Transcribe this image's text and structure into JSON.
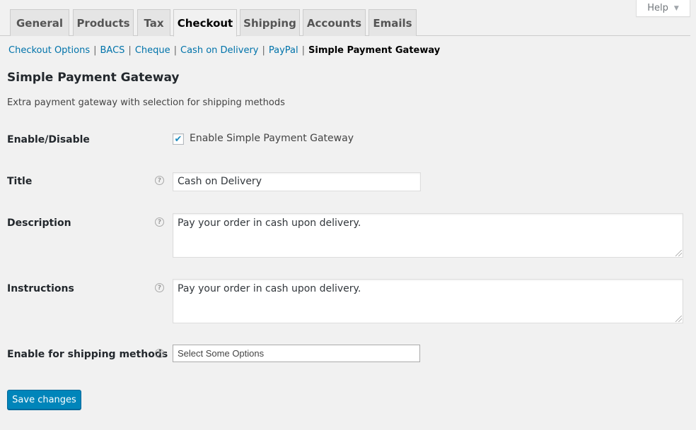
{
  "help": {
    "label": "Help",
    "arrow": "▼"
  },
  "tabs": [
    {
      "label": "General",
      "active": false
    },
    {
      "label": "Products",
      "active": false
    },
    {
      "label": "Tax",
      "active": false
    },
    {
      "label": "Checkout",
      "active": true
    },
    {
      "label": "Shipping",
      "active": false
    },
    {
      "label": "Accounts",
      "active": false
    },
    {
      "label": "Emails",
      "active": false
    }
  ],
  "subnav": {
    "links": [
      "Checkout Options",
      "BACS",
      "Cheque",
      "Cash on Delivery",
      "PayPal"
    ],
    "current": "Simple Payment Gateway",
    "separator": "|"
  },
  "section": {
    "title": "Simple Payment Gateway",
    "description": "Extra payment gateway with selection for shipping methods"
  },
  "fields": {
    "enable": {
      "label": "Enable/Disable",
      "checkbox_label": "Enable Simple Payment Gateway",
      "checked": true,
      "check_glyph": "✔"
    },
    "title": {
      "label": "Title",
      "value": "Cash on Delivery"
    },
    "description": {
      "label": "Description",
      "value": "Pay your order in cash upon delivery."
    },
    "instructions": {
      "label": "Instructions",
      "value": "Pay your order in cash upon delivery."
    },
    "shipping_methods": {
      "label": "Enable for shipping methods",
      "placeholder": "Select Some Options"
    }
  },
  "help_tip_glyph": "?",
  "save_button": {
    "label": "Save changes"
  },
  "colors": {
    "link": "#0073aa",
    "primary_button": "#0085ba",
    "checkmark": "#1e8cbe",
    "background": "#f1f1f1"
  }
}
